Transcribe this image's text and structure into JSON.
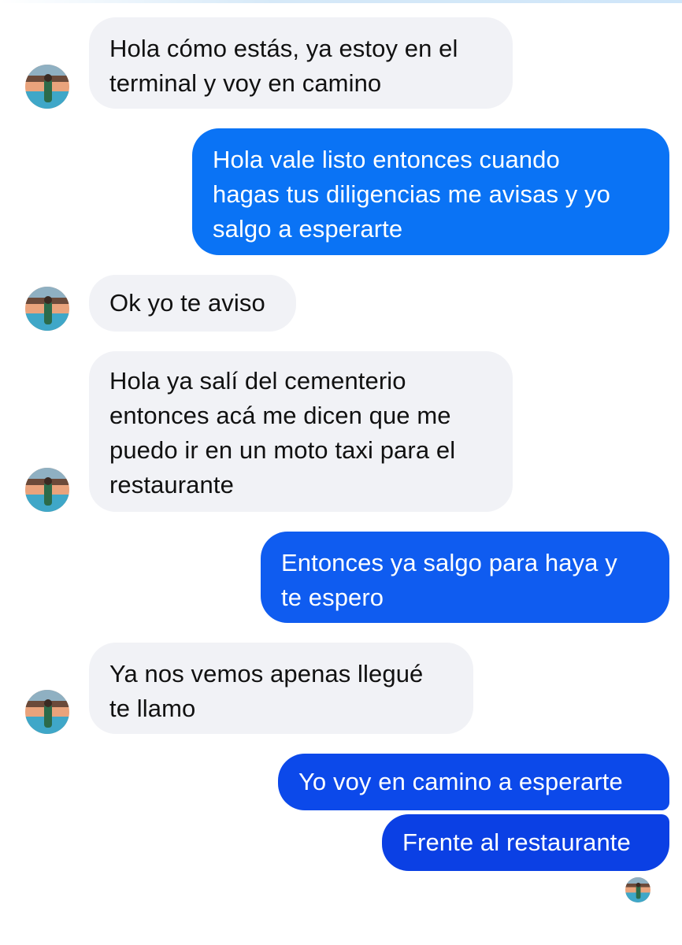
{
  "conversation": {
    "messages": [
      {
        "sender": "contact",
        "text": "Hola cómo estás, ya estoy en el\nterminal y voy en camino"
      },
      {
        "sender": "me",
        "text": "Hola vale listo entonces cuando\nhagas tus diligencias me avisas y yo\nsalgo a esperarte"
      },
      {
        "sender": "contact",
        "text": "Ok yo te aviso"
      },
      {
        "sender": "contact",
        "text": "Hola ya salí del cementerio\nentonces acá me dicen que me\npuedo ir en un moto taxi para el\nrestaurante"
      },
      {
        "sender": "me",
        "text": "Entonces ya salgo para haya y\nte espero"
      },
      {
        "sender": "contact",
        "text": "Ya nos vemos apenas llegué\nte llamo"
      },
      {
        "sender": "me",
        "text": "Yo voy en camino a esperarte"
      },
      {
        "sender": "me",
        "text": "Frente al restaurante"
      }
    ]
  },
  "colors": {
    "incoming_bubble": "#f1f2f6",
    "outgoing_bubble_top": "#0a73f5",
    "outgoing_bubble_bottom": "#0b40e4"
  },
  "icons": {
    "contact_avatar": "contact-avatar-icon",
    "read_receipt": "read-receipt-avatar-icon"
  }
}
